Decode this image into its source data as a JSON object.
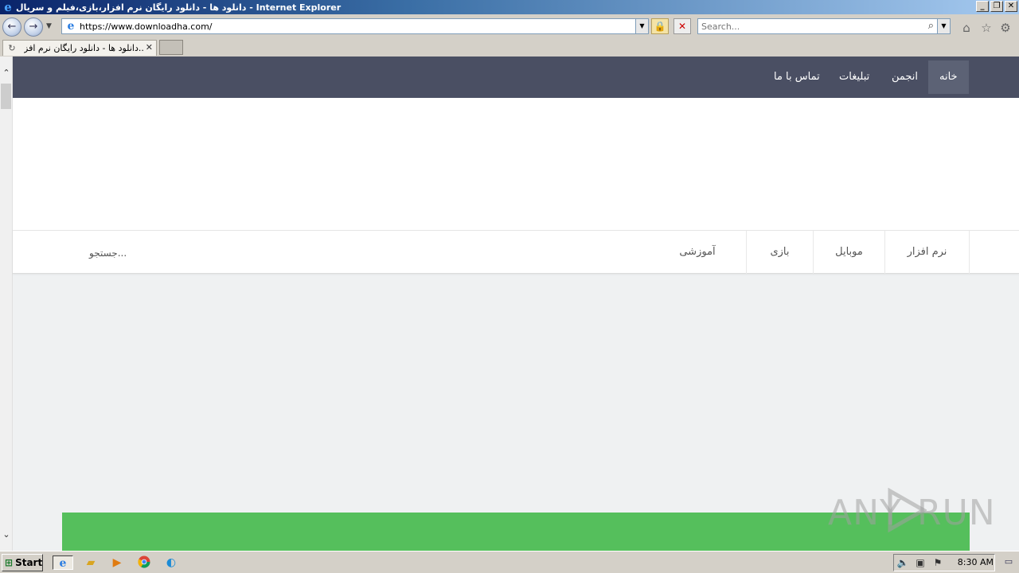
{
  "window": {
    "title": "دانلود ها - دانلود رایگان نرم افزار،بازی،فیلم و سریال - Internet Explorer",
    "minimize_glyph": "_",
    "restore_glyph": "❐",
    "close_glyph": "✕"
  },
  "toolbar": {
    "back_glyph": "←",
    "forward_glyph": "→",
    "address_url": "https://www.downloadha.com/",
    "search_placeholder": "Search...",
    "lock_glyph": "🔒",
    "stop_glyph": "✕"
  },
  "tabs": [
    {
      "label": "دانلود ها - دانلود رایگان نرم افز...",
      "close_glyph": "✕"
    }
  ],
  "site_nav": {
    "items": [
      {
        "label": "خانه",
        "active": true
      },
      {
        "label": "انجمن",
        "active": false
      },
      {
        "label": "تبلیغات",
        "active": false
      },
      {
        "label": "تماس با ما",
        "active": false
      }
    ]
  },
  "categories": [
    {
      "label": "نرم افزار"
    },
    {
      "label": "موبایل"
    },
    {
      "label": "بازی"
    },
    {
      "label": "آموزشی"
    }
  ],
  "site_search_label": "جستجو...",
  "watermark": {
    "text_left": "ANY",
    "text_right": "RUN"
  },
  "taskbar": {
    "start_label": "Start",
    "clock": "8:30 AM"
  },
  "colors": {
    "site_nav_bg": "#4a4f63",
    "site_nav_active": "#5c6275",
    "green_block": "#55bf5c",
    "page_bg": "#eff1f2"
  },
  "icons": {
    "ie": "ie-logo-icon",
    "home": "home-icon",
    "favorites": "star-icon",
    "tools": "gear-icon",
    "search": "magnifier-icon"
  }
}
